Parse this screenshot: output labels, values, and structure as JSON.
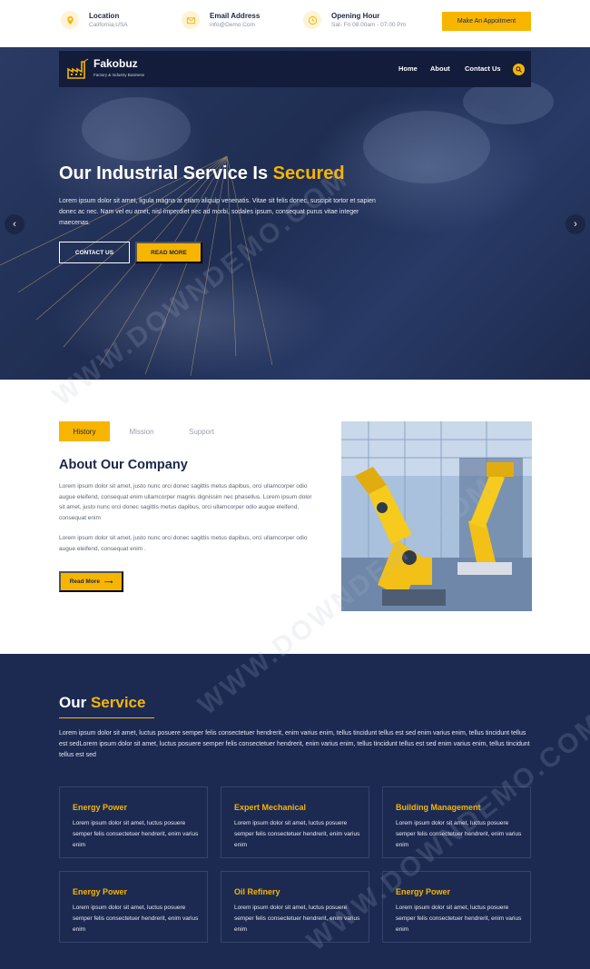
{
  "topbar": {
    "location": {
      "title": "Location",
      "value": "California,USA",
      "icon": "map-pin-icon"
    },
    "email": {
      "title": "Email Address",
      "value": "info@Demo.Com",
      "icon": "envelope-icon"
    },
    "hours": {
      "title": "Opening Hour",
      "value": "Sat- Fri 08.00am - 07.00 Pm",
      "icon": "clock-icon"
    },
    "appointment_label": "Make An Appoitment"
  },
  "nav": {
    "brand": "Fakobuz",
    "tagline": "Factory & Industry Business",
    "links": [
      "Home",
      "About",
      "Contact Us"
    ]
  },
  "hero": {
    "title_plain": "Our Industrial Service Is ",
    "title_highlight": "Secured",
    "text": "Lorem ipsum dolor sit amet, ligula magna at etiam aliquip venenatis. Vitae sit felis donec, suscipit tortor et sapien donec ac nec. Nam vel eu amet, nisl imperdiet nec ad morbi, sodales ipsum, consequat purus vitae integer maecenas.",
    "contact_label": "CONTACT US",
    "read_more_label": "READ MORE",
    "prev": "‹",
    "next": "›"
  },
  "about": {
    "tabs": [
      "History",
      "Mission",
      "Support"
    ],
    "title": "About Our Company",
    "paragraph1": "Lorem ipsum dolor sit amet, justo nunc orci donec sagittis metus dapibus, orci ullamcorper odio augue eleifend, consequat enim ullamcorper magnis dignissim nec phasellus. Lorem ipsum dolor sit amet, justo nunc orci donec sagittis metus dapibus, orci ullamcorper odio augue eleifend, consequat enim",
    "paragraph2": "Lorem ipsum dolor sit amet, justo nunc orci donec sagittis metus dapibus, orci ullamcorper odio augue eleifend, consequat enim .",
    "read_more_label": "Read More",
    "arrow": "⟶"
  },
  "services": {
    "title_plain": "Our ",
    "title_highlight": "Service",
    "intro": "Lorem ipsum dolor sit amet, luctus posuere semper felis consectetuer hendrerit, enim varius enim, tellus tincidunt tellus est sed enim varius enim, tellus tincidunt tellus est sedLorem ipsum dolor sit amet, luctus posuere semper felis consectetuer hendrerit, enim varius enim, tellus tincidunt tellus est sed enim varius enim, tellus tincidunt tellus est sed",
    "cards": [
      {
        "title": "Energy Power",
        "text": "Lorem ipsum dolor sit amet, luctus posuere semper felis consectetuer hendrerit, enim varius enim"
      },
      {
        "title": "Expert Mechanical",
        "text": "Lorem ipsum dolor sit amet, luctus posuere semper felis consectetuer hendrerit, enim varius enim"
      },
      {
        "title": "Building Management",
        "text": "Lorem ipsum dolor sit amet, luctus posuere semper felis consectetuer hendrerit, enim varius enim"
      },
      {
        "title": "Energy Power",
        "text": "Lorem ipsum dolor sit amet, luctus posuere semper felis consectetuer hendrerit, enim varius enim"
      },
      {
        "title": "Oil Refinery",
        "text": "Lorem ipsum dolor sit amet, luctus posuere semper felis consectetuer hendrerit, enim varius enim"
      },
      {
        "title": "Energy Power",
        "text": "Lorem ipsum dolor sit amet, luctus posuere semper felis consectetuer hendrerit, enim varius enim"
      }
    ]
  },
  "watermark": "WWW.DOWNDEMO.COM",
  "colors": {
    "accent": "#f7b500",
    "navy": "#1c2a52",
    "dark_nav": "#131c3a"
  }
}
